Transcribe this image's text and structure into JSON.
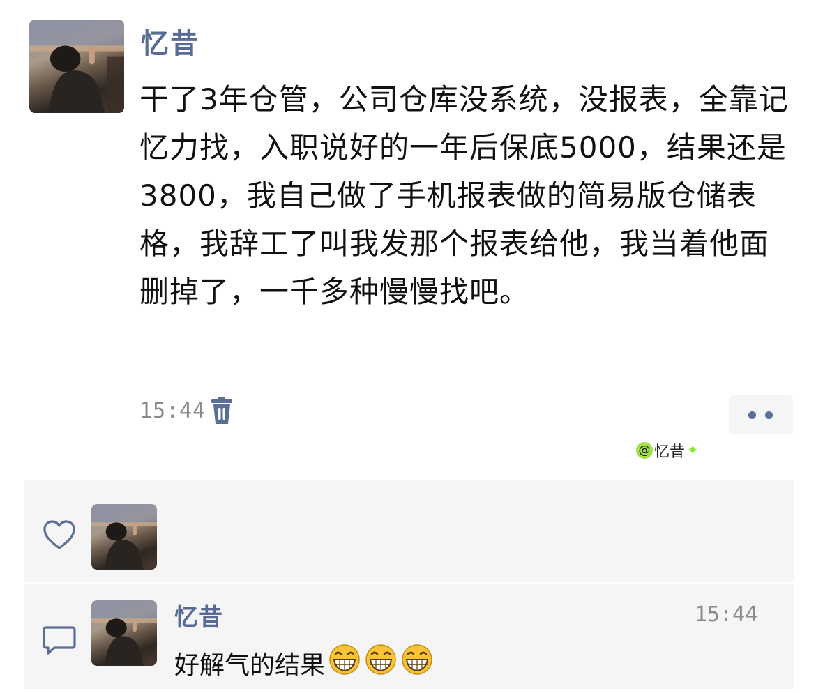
{
  "post": {
    "author": "忆昔",
    "body": "干了3年仓管，公司仓库没系统，没报表，全靠记忆力找，入职说好的一年后保底5000，结果还是3800，我自己做了手机报表做的简易版仓储表格，我辞工了叫我发那个报表给他，我当着他面删掉了，一千多种慢慢找吧。",
    "time": "15:44"
  },
  "watermark": {
    "at": "@",
    "name": "忆昔"
  },
  "comments": [
    {
      "author": "忆昔",
      "time": "15:44",
      "text": "好解气的结果",
      "emoji_count": 3
    }
  ],
  "icons": {
    "delete": "trash-icon",
    "more": "more-dots-icon",
    "like": "heart-outline-icon",
    "comment": "comment-bubble-icon",
    "emoji": "grinning-face-emoji"
  },
  "colors": {
    "name": "#576b95",
    "panel": "#f5f5f5",
    "time": "#8a8a8a"
  }
}
